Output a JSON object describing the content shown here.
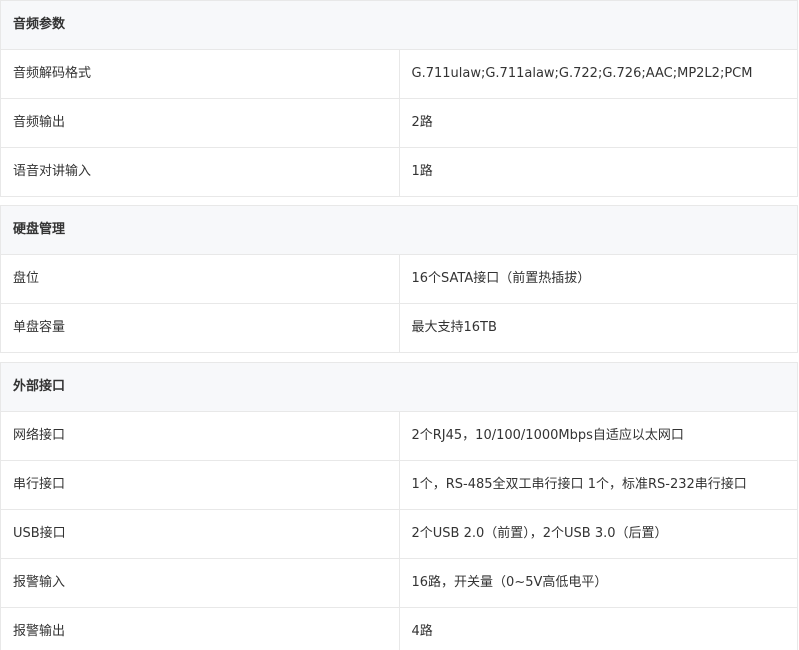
{
  "sections": [
    {
      "title": "音频参数",
      "rows": [
        {
          "label": "音频解码格式",
          "value": "G.711ulaw;G.711alaw;G.722;G.726;AAC;MP2L2;PCM"
        },
        {
          "label": "音频输出",
          "value": "2路"
        },
        {
          "label": "语音对讲输入",
          "value": "1路"
        }
      ]
    },
    {
      "title": "硬盘管理",
      "rows": [
        {
          "label": "盘位",
          "value": "16个SATA接口（前置热插拔）"
        },
        {
          "label": "单盘容量",
          "value": "最大支持16TB"
        }
      ]
    },
    {
      "title": "外部接口",
      "rows": [
        {
          "label": "网络接口",
          "value": "2个RJ45，10/100/1000Mbps自适应以太网口"
        },
        {
          "label": "串行接口",
          "value": "1个，RS-485全双工串行接口 1个，标准RS-232串行接口"
        },
        {
          "label": "USB接口",
          "value": "2个USB 2.0（前置），2个USB 3.0（后置）"
        },
        {
          "label": "报警输入",
          "value": "16路，开关量（0~5V高低电平）"
        },
        {
          "label": "报警输出",
          "value": "4路"
        }
      ]
    }
  ]
}
